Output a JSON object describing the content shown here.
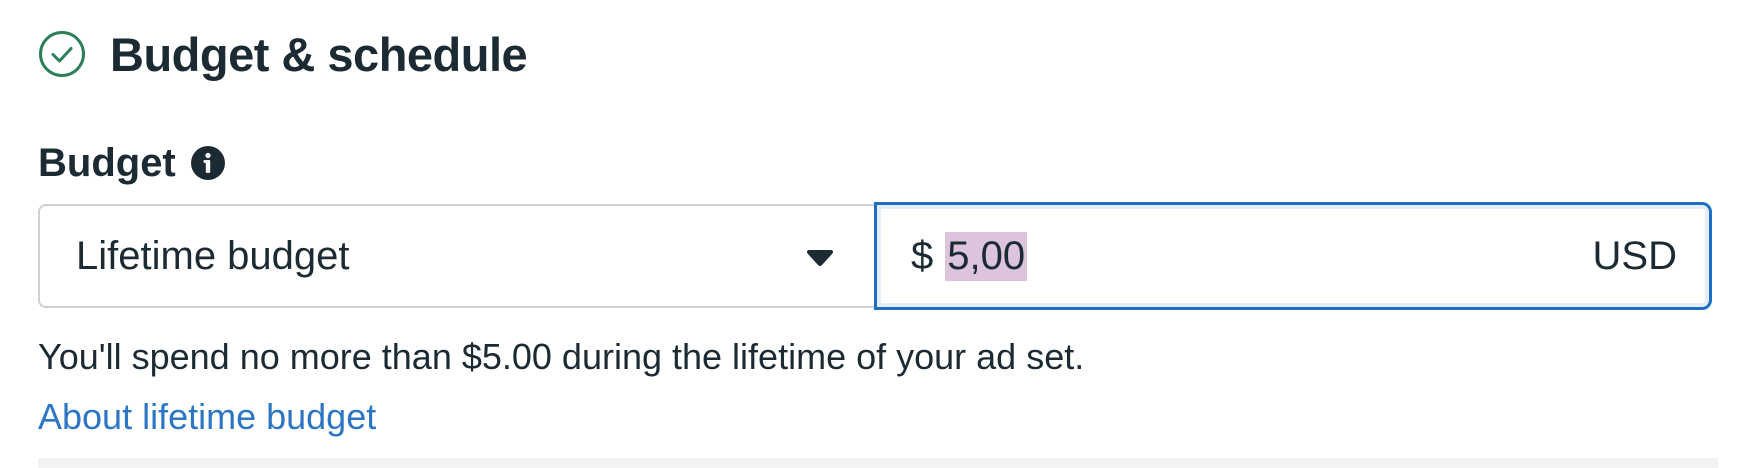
{
  "section": {
    "title": "Budget & schedule",
    "status_icon": "check-circle-icon",
    "accent_color": "#2e7d5b"
  },
  "budget": {
    "label": "Budget",
    "info_icon": "info-icon",
    "type_select": {
      "selected": "Lifetime budget",
      "icon": "chevron-down-icon"
    },
    "amount_input": {
      "currency_symbol": "$",
      "value": "5,00",
      "currency_code": "USD",
      "focus_color": "#1d6fc4",
      "selection_color": "#dcc4dc"
    },
    "helper_text": "You'll spend no more than $5.00 during the lifetime of your ad set.",
    "help_link": "About lifetime budget",
    "link_color": "#2d76c4"
  }
}
